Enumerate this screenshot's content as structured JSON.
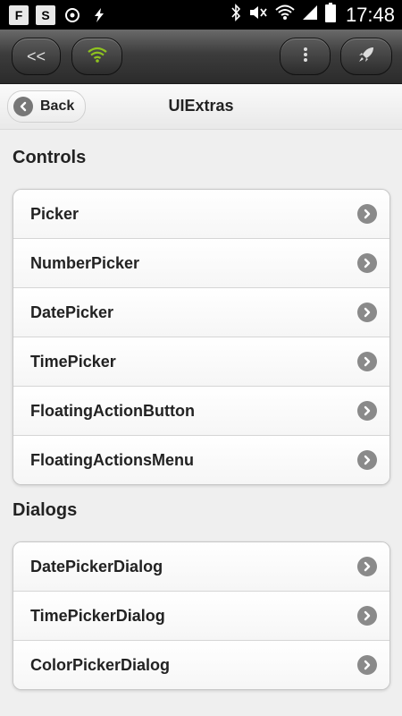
{
  "status_bar": {
    "time": "17:48",
    "icons": [
      "flipboard-icon",
      "s-app-icon",
      "sync-icon",
      "flash-icon",
      "bluetooth-icon",
      "mute-icon",
      "wifi-icon",
      "signal-icon",
      "battery-icon"
    ]
  },
  "toolbar": {
    "back_label": "<<",
    "wifi_icon": "wifi-icon",
    "menu_icon": "more-vert-icon",
    "rocket_icon": "rocket-icon",
    "accent": "#8fc31f"
  },
  "header": {
    "back_label": "Back",
    "title": "UIExtras"
  },
  "sections": [
    {
      "title": "Controls",
      "items": [
        "Picker",
        "NumberPicker",
        "DatePicker",
        "TimePicker",
        "FloatingActionButton",
        "FloatingActionsMenu"
      ]
    },
    {
      "title": "Dialogs",
      "items": [
        "DatePickerDialog",
        "TimePickerDialog",
        "ColorPickerDialog"
      ]
    }
  ]
}
